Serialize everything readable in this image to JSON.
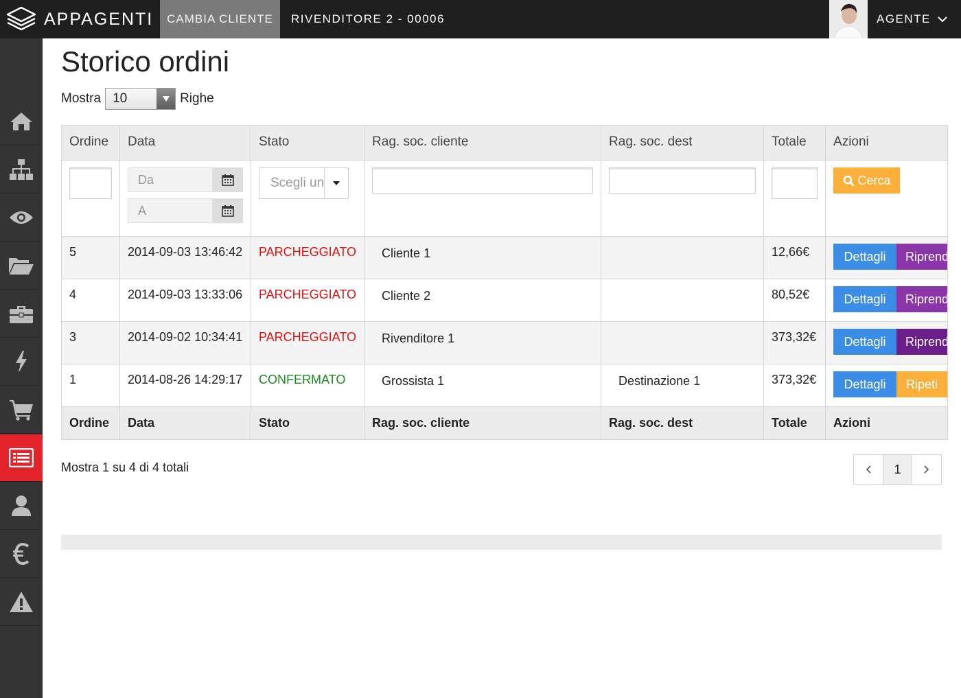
{
  "header": {
    "brand": "APPAGENTI",
    "change_client": "CAMBIA CLIENTE",
    "reseller": "RIVENDITORE 2 - 00006",
    "user": "AGENTE"
  },
  "sidebar": {
    "items": [
      {
        "icon": "home-icon"
      },
      {
        "icon": "sitemap-icon"
      },
      {
        "icon": "eye-icon"
      },
      {
        "icon": "folder-open-icon"
      },
      {
        "icon": "briefcase-icon"
      },
      {
        "icon": "bolt-icon"
      },
      {
        "icon": "shopping-cart-icon"
      },
      {
        "icon": "list-icon",
        "active": true
      },
      {
        "icon": "user-icon"
      },
      {
        "icon": "euro-icon"
      },
      {
        "icon": "warning-icon"
      }
    ],
    "active_color": "#e3242b"
  },
  "page": {
    "title": "Storico ordini",
    "show_label": "Mostra",
    "rows_value": "10",
    "rows_label": "Righe"
  },
  "table": {
    "columns": [
      "Ordine",
      "Data",
      "Stato",
      "Rag. soc. cliente",
      "Rag. soc. dest",
      "Totale",
      "Azioni"
    ],
    "filters": {
      "date_from_placeholder": "Da",
      "date_to_placeholder": "A",
      "status_placeholder": "Scegli un",
      "search_button": "Cerca"
    },
    "rows": [
      {
        "order": "5",
        "date": "2014-09-03 13:46:42",
        "status": "PARCHEGGIATO",
        "client": "Cliente 1",
        "dest": "",
        "total": "12,66€",
        "details": "Dettagli",
        "action2": "Riprendi"
      },
      {
        "order": "4",
        "date": "2014-09-03 13:33:06",
        "status": "PARCHEGGIATO",
        "client": "Cliente 2",
        "dest": "",
        "total": "80,52€",
        "details": "Dettagli",
        "action2": "Riprendi"
      },
      {
        "order": "3",
        "date": "2014-09-02 10:34:41",
        "status": "PARCHEGGIATO",
        "client": "Rivenditore 1",
        "dest": "",
        "total": "373,32€",
        "details": "Dettagli",
        "action2": "Riprendi"
      },
      {
        "order": "1",
        "date": "2014-08-26 14:29:17",
        "status": "CONFERMATO",
        "client": "Grossista 1",
        "dest": "Destinazione 1",
        "total": "373,32€",
        "details": "Dettagli",
        "action2": "Ripeti"
      }
    ],
    "status_colors": {
      "PARCHEGGIATO": "#e01313",
      "CONFERMATO": "#1d8a1d"
    }
  },
  "footer": {
    "info": "Mostra 1 su 4 di 4 totali",
    "current_page": "1"
  }
}
